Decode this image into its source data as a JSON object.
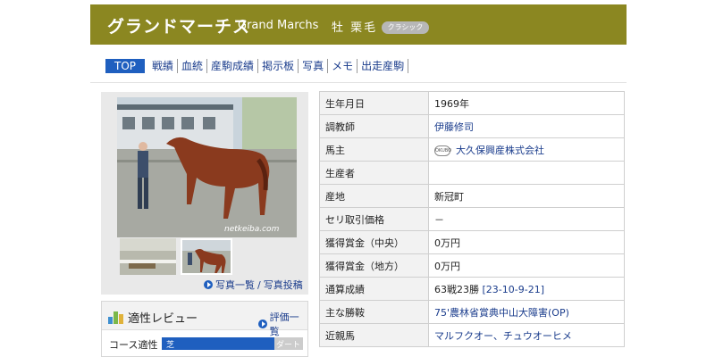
{
  "header": {
    "name_ja": "グランドマーチス",
    "name_en": "Grand Marchs",
    "sex_color": "牡 栗毛",
    "badge": "クラシック",
    "bg_color": "#8b8721"
  },
  "nav": {
    "items": [
      {
        "label": "TOP",
        "active": true
      },
      {
        "label": "戦績"
      },
      {
        "label": "血統"
      },
      {
        "label": "産駒成績"
      },
      {
        "label": "掲示板"
      },
      {
        "label": "写真"
      },
      {
        "label": "メモ"
      },
      {
        "label": "出走産駒"
      }
    ]
  },
  "photo": {
    "watermark": "netkeiba.com",
    "links": {
      "list": "写真一覧",
      "separator": "/",
      "post": "写真投稿"
    }
  },
  "review": {
    "title": "適性レビュー",
    "link": "評価一覧",
    "course_label": "コース適性",
    "course_left": "芝",
    "course_right": "ダート",
    "course_value_pct": 80
  },
  "profile": {
    "rows": [
      {
        "key": "生年月日",
        "value": "1969年"
      },
      {
        "key": "調教師",
        "value": "伊藤修司",
        "link": true
      },
      {
        "key": "馬主",
        "value": "大久保興産株式会社",
        "link": true,
        "logo": "OKUBO"
      },
      {
        "key": "生産者",
        "value": ""
      },
      {
        "key": "産地",
        "value": "新冠町"
      },
      {
        "key": "セリ取引価格",
        "value": "－"
      },
      {
        "key": "獲得賞金（中央）",
        "value": "0万円"
      },
      {
        "key": "獲得賞金（地方）",
        "value": "0万円"
      },
      {
        "key": "通算成績",
        "value": "63戦23勝",
        "extra": "[23-10-9-21]"
      },
      {
        "key": "主な勝鞍",
        "value": "75'農林省賞典中山大障害(OP)",
        "link": true
      },
      {
        "key": "近親馬",
        "value": "マルフクオー、チュウオーヒメ",
        "link": true
      }
    ]
  }
}
